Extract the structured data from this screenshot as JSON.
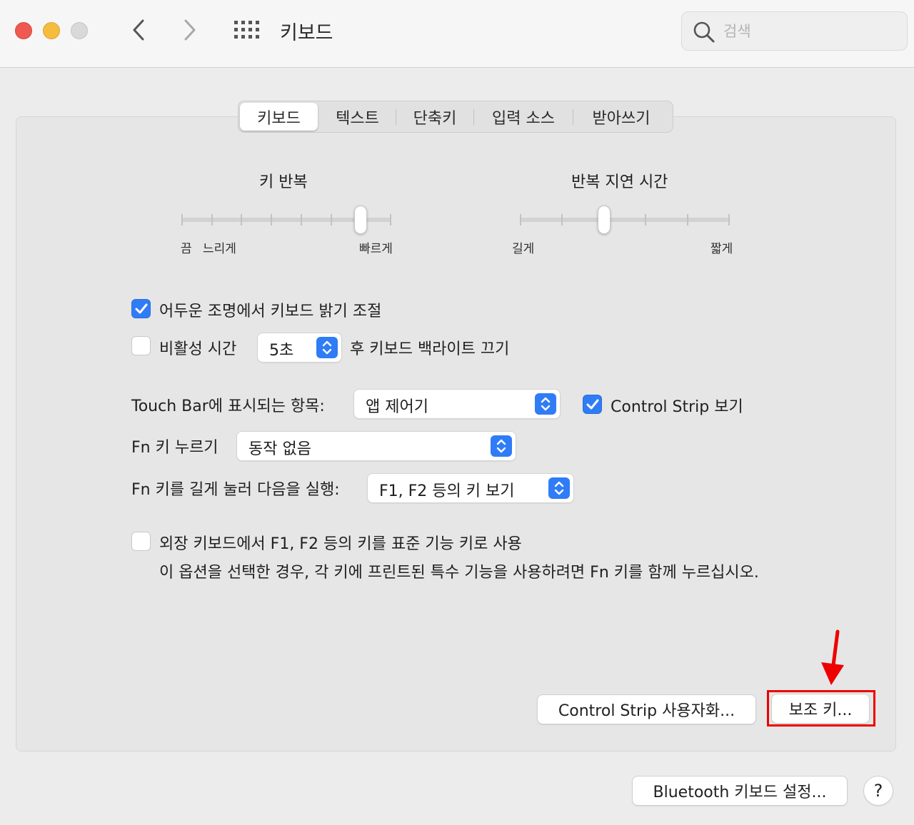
{
  "window": {
    "title": "키보드"
  },
  "search": {
    "placeholder": "검색"
  },
  "tabs": [
    {
      "label": "키보드",
      "selected": true
    },
    {
      "label": "텍스트",
      "selected": false
    },
    {
      "label": "단축키",
      "selected": false
    },
    {
      "label": "입력 소스",
      "selected": false
    },
    {
      "label": "받아쓰기",
      "selected": false
    }
  ],
  "key_repeat": {
    "title": "키 반복",
    "label_off": "끔",
    "label_slow": "느리게",
    "label_fast": "빠르게",
    "positions": 8,
    "value_index": 6
  },
  "repeat_delay": {
    "title": "반복 지연 시간",
    "label_long": "길게",
    "label_short": "짧게",
    "positions": 6,
    "value_index": 2
  },
  "options": {
    "adjust_brightness": {
      "label": "어두운 조명에서 키보드 밝기 조절",
      "checked": true
    },
    "backlight_off": {
      "label": "비활성 시간",
      "value": "5초",
      "suffix": "후 키보드 백라이트 끄기",
      "checked": false
    },
    "touchbar": {
      "label": "Touch Bar에 표시되는 항목:",
      "value": "앱 제어기"
    },
    "control_strip": {
      "label": "Control Strip 보기",
      "checked": true
    },
    "fn_press": {
      "label": "Fn 키 누르기",
      "value": "동작 없음"
    },
    "fn_hold": {
      "label": "Fn 키를 길게 눌러 다음을 실행:",
      "value": "F1, F2 등의 키 보기"
    },
    "standard_fn": {
      "label": "외장 키보드에서 F1, F2 등의 키를 표준 기능 키로 사용",
      "description": "이 옵션을 선택한 경우, 각 키에 프린트된 특수 기능을 사용하려면 Fn 키를 함께 누르십시오.",
      "checked": false
    }
  },
  "buttons": {
    "customize_control_strip": "Control Strip 사용자화...",
    "modifier_keys": "보조 키...",
    "bluetooth_setup": "Bluetooth 키보드 설정...",
    "help": "?"
  },
  "colors": {
    "accent": "#2f7cf6",
    "annotation": "#ee0000"
  }
}
